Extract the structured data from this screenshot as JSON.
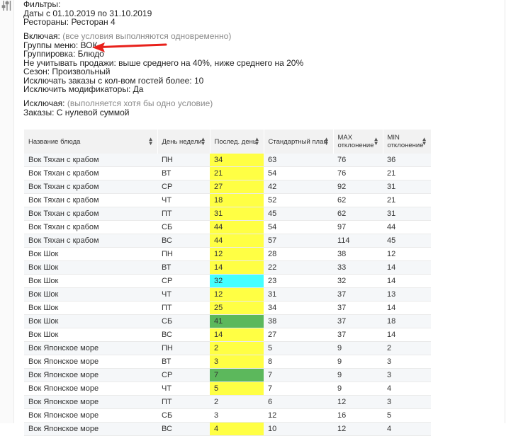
{
  "filters": {
    "title": "Фильтры:",
    "dates": "Даты с 01.10.2019 по 31.10.2019",
    "restaurants": "Рестораны: Ресторан 4",
    "include_label": "Включая:",
    "include_hint": "(все условия выполняются одновременно)",
    "menu_groups": "Группы меню: ВОК",
    "grouping": "Группировка: Блюдо",
    "ignore_sales": "Не учитывать продажи: выше среднего на 40%, ниже среднего на 20%",
    "season": "Сезон: Произвольный",
    "exclude_orders": "Исключать заказы с кол-вом гостей более: 10",
    "exclude_modifiers": "Исключить модификаторы: Да",
    "exclude_label": "Исключая:",
    "exclude_hint": "(выполняется хотя бы одно условие)",
    "orders": "Заказы: С нулевой суммой"
  },
  "colors": {
    "yellow": "#ffff44",
    "cyan": "#44ffff",
    "green": "#5cb85c",
    "arrow": "#e8211b"
  },
  "table": {
    "headers": [
      {
        "label": "Название блюда"
      },
      {
        "label": "День недели"
      },
      {
        "label": "Послед. день"
      },
      {
        "label": "Стандартный план"
      },
      {
        "label": "MAX отклонение"
      },
      {
        "label": "MIN отклонение"
      }
    ],
    "rows": [
      [
        "Вок Тяхан с крабом",
        "ПН",
        "34",
        "63",
        "76",
        "36",
        "y"
      ],
      [
        "Вок Тяхан с крабом",
        "ВТ",
        "21",
        "54",
        "76",
        "21",
        "y"
      ],
      [
        "Вок Тяхан с крабом",
        "СР",
        "27",
        "42",
        "92",
        "31",
        "y"
      ],
      [
        "Вок Тяхан с крабом",
        "ЧТ",
        "18",
        "52",
        "62",
        "21",
        "y"
      ],
      [
        "Вок Тяхан с крабом",
        "ПТ",
        "31",
        "45",
        "62",
        "31",
        "y"
      ],
      [
        "Вок Тяхан с крабом",
        "СБ",
        "44",
        "54",
        "97",
        "44",
        "y"
      ],
      [
        "Вок Тяхан с крабом",
        "ВС",
        "44",
        "57",
        "114",
        "45",
        "y"
      ],
      [
        "Вок Шок",
        "ПН",
        "12",
        "28",
        "38",
        "12",
        "y"
      ],
      [
        "Вок Шок",
        "ВТ",
        "14",
        "22",
        "33",
        "14",
        "y"
      ],
      [
        "Вок Шок",
        "СР",
        "32",
        "23",
        "32",
        "14",
        "c"
      ],
      [
        "Вок Шок",
        "ЧТ",
        "12",
        "31",
        "37",
        "13",
        "y"
      ],
      [
        "Вок Шок",
        "ПТ",
        "25",
        "34",
        "37",
        "14",
        "y"
      ],
      [
        "Вок Шок",
        "СБ",
        "41",
        "38",
        "37",
        "18",
        "g"
      ],
      [
        "Вок Шок",
        "ВС",
        "14",
        "27",
        "37",
        "14",
        "y"
      ],
      [
        "Вок Японское море",
        "ПН",
        "2",
        "5",
        "9",
        "2",
        "y"
      ],
      [
        "Вок Японское море",
        "ВТ",
        "3",
        "8",
        "9",
        "3",
        "y"
      ],
      [
        "Вок Японское море",
        "СР",
        "7",
        "7",
        "9",
        "3",
        "g"
      ],
      [
        "Вок Японское море",
        "ЧТ",
        "5",
        "7",
        "9",
        "4",
        "y"
      ],
      [
        "Вок Японское море",
        "ПТ",
        "2",
        "6",
        "12",
        "3",
        ""
      ],
      [
        "Вок Японское море",
        "СБ",
        "3",
        "12",
        "16",
        "5",
        ""
      ],
      [
        "Вок Японское море",
        "ВС",
        "4",
        "10",
        "12",
        "4",
        "y"
      ]
    ]
  }
}
